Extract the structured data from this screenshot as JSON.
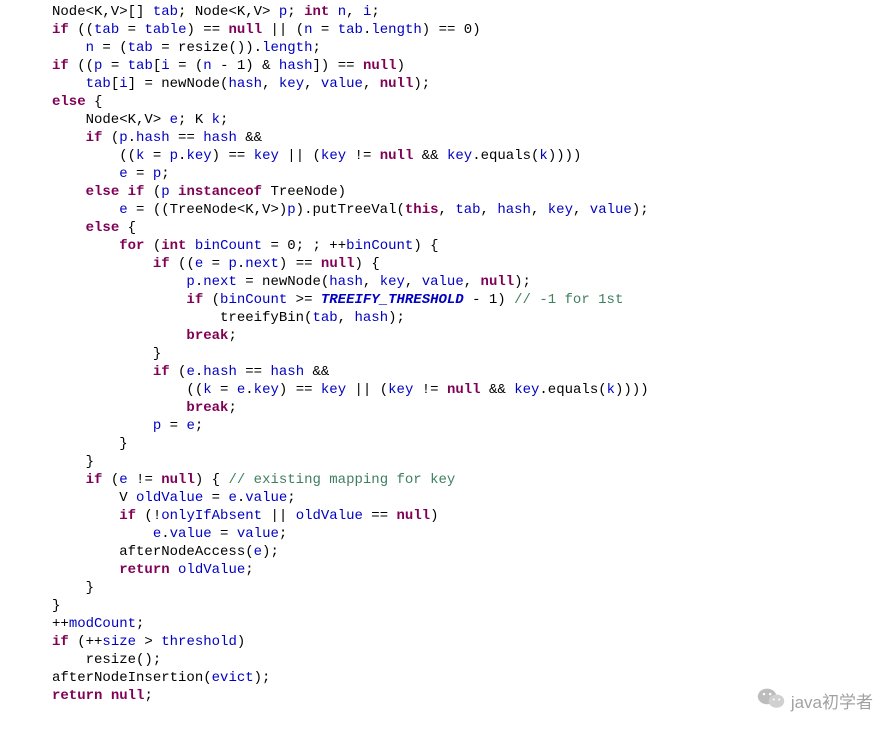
{
  "code": {
    "tokens": [
      [
        {
          "c": "type",
          "t": "Node<K,V>[] "
        },
        {
          "c": "field",
          "t": "tab"
        },
        {
          "t": "; Node<K,V> "
        },
        {
          "c": "field",
          "t": "p"
        },
        {
          "t": "; "
        },
        {
          "c": "kw",
          "t": "int"
        },
        {
          "t": " "
        },
        {
          "c": "field",
          "t": "n"
        },
        {
          "t": ", "
        },
        {
          "c": "field",
          "t": "i"
        },
        {
          "t": ";"
        }
      ],
      [
        {
          "c": "kw",
          "t": "if"
        },
        {
          "t": " (("
        },
        {
          "c": "field",
          "t": "tab"
        },
        {
          "t": " = "
        },
        {
          "c": "field",
          "t": "table"
        },
        {
          "t": ") == "
        },
        {
          "c": "kw",
          "t": "null"
        },
        {
          "t": " || ("
        },
        {
          "c": "field",
          "t": "n"
        },
        {
          "t": " = "
        },
        {
          "c": "field",
          "t": "tab"
        },
        {
          "t": "."
        },
        {
          "c": "field",
          "t": "length"
        },
        {
          "t": ") == 0)"
        }
      ],
      [
        {
          "t": "    "
        },
        {
          "c": "field",
          "t": "n"
        },
        {
          "t": " = ("
        },
        {
          "c": "field",
          "t": "tab"
        },
        {
          "t": " = resize())."
        },
        {
          "c": "field",
          "t": "length"
        },
        {
          "t": ";"
        }
      ],
      [
        {
          "c": "kw",
          "t": "if"
        },
        {
          "t": " (("
        },
        {
          "c": "field",
          "t": "p"
        },
        {
          "t": " = "
        },
        {
          "c": "field",
          "t": "tab"
        },
        {
          "t": "["
        },
        {
          "c": "field",
          "t": "i"
        },
        {
          "t": " = ("
        },
        {
          "c": "field",
          "t": "n"
        },
        {
          "t": " - 1) & "
        },
        {
          "c": "field",
          "t": "hash"
        },
        {
          "t": "]) == "
        },
        {
          "c": "kw",
          "t": "null"
        },
        {
          "t": ")"
        }
      ],
      [
        {
          "t": "    "
        },
        {
          "c": "field",
          "t": "tab"
        },
        {
          "t": "["
        },
        {
          "c": "field",
          "t": "i"
        },
        {
          "t": "] = newNode("
        },
        {
          "c": "field",
          "t": "hash"
        },
        {
          "t": ", "
        },
        {
          "c": "field",
          "t": "key"
        },
        {
          "t": ", "
        },
        {
          "c": "field",
          "t": "value"
        },
        {
          "t": ", "
        },
        {
          "c": "kw",
          "t": "null"
        },
        {
          "t": ");"
        }
      ],
      [
        {
          "c": "kw",
          "t": "else"
        },
        {
          "t": " {"
        }
      ],
      [
        {
          "t": "    Node<K,V> "
        },
        {
          "c": "field",
          "t": "e"
        },
        {
          "t": "; K "
        },
        {
          "c": "field",
          "t": "k"
        },
        {
          "t": ";"
        }
      ],
      [
        {
          "t": "    "
        },
        {
          "c": "kw",
          "t": "if"
        },
        {
          "t": " ("
        },
        {
          "c": "field",
          "t": "p"
        },
        {
          "t": "."
        },
        {
          "c": "field",
          "t": "hash"
        },
        {
          "t": " == "
        },
        {
          "c": "field",
          "t": "hash"
        },
        {
          "t": " &&"
        }
      ],
      [
        {
          "t": "        (("
        },
        {
          "c": "field",
          "t": "k"
        },
        {
          "t": " = "
        },
        {
          "c": "field",
          "t": "p"
        },
        {
          "t": "."
        },
        {
          "c": "field",
          "t": "key"
        },
        {
          "t": ") == "
        },
        {
          "c": "field",
          "t": "key"
        },
        {
          "t": " || ("
        },
        {
          "c": "field",
          "t": "key"
        },
        {
          "t": " != "
        },
        {
          "c": "kw",
          "t": "null"
        },
        {
          "t": " && "
        },
        {
          "c": "field",
          "t": "key"
        },
        {
          "t": ".equals("
        },
        {
          "c": "field",
          "t": "k"
        },
        {
          "t": "))))"
        }
      ],
      [
        {
          "t": "        "
        },
        {
          "c": "field",
          "t": "e"
        },
        {
          "t": " = "
        },
        {
          "c": "field",
          "t": "p"
        },
        {
          "t": ";"
        }
      ],
      [
        {
          "t": "    "
        },
        {
          "c": "kw",
          "t": "else if"
        },
        {
          "t": " ("
        },
        {
          "c": "field",
          "t": "p"
        },
        {
          "t": " "
        },
        {
          "c": "kw",
          "t": "instanceof"
        },
        {
          "t": " TreeNode)"
        }
      ],
      [
        {
          "t": "        "
        },
        {
          "c": "field",
          "t": "e"
        },
        {
          "t": " = ((TreeNode<K,V>)"
        },
        {
          "c": "field",
          "t": "p"
        },
        {
          "t": ").putTreeVal("
        },
        {
          "c": "kw",
          "t": "this"
        },
        {
          "t": ", "
        },
        {
          "c": "field",
          "t": "tab"
        },
        {
          "t": ", "
        },
        {
          "c": "field",
          "t": "hash"
        },
        {
          "t": ", "
        },
        {
          "c": "field",
          "t": "key"
        },
        {
          "t": ", "
        },
        {
          "c": "field",
          "t": "value"
        },
        {
          "t": ");"
        }
      ],
      [
        {
          "t": "    "
        },
        {
          "c": "kw",
          "t": "else"
        },
        {
          "t": " {"
        }
      ],
      [
        {
          "t": "        "
        },
        {
          "c": "kw",
          "t": "for"
        },
        {
          "t": " ("
        },
        {
          "c": "kw",
          "t": "int"
        },
        {
          "t": " "
        },
        {
          "c": "field",
          "t": "binCount"
        },
        {
          "t": " = 0; ; ++"
        },
        {
          "c": "field",
          "t": "binCount"
        },
        {
          "t": ") {"
        }
      ],
      [
        {
          "t": "            "
        },
        {
          "c": "kw",
          "t": "if"
        },
        {
          "t": " (("
        },
        {
          "c": "field",
          "t": "e"
        },
        {
          "t": " = "
        },
        {
          "c": "field",
          "t": "p"
        },
        {
          "t": "."
        },
        {
          "c": "field",
          "t": "next"
        },
        {
          "t": ") == "
        },
        {
          "c": "kw",
          "t": "null"
        },
        {
          "t": ") {"
        }
      ],
      [
        {
          "t": "                "
        },
        {
          "c": "field",
          "t": "p"
        },
        {
          "t": "."
        },
        {
          "c": "field",
          "t": "next"
        },
        {
          "t": " = newNode("
        },
        {
          "c": "field",
          "t": "hash"
        },
        {
          "t": ", "
        },
        {
          "c": "field",
          "t": "key"
        },
        {
          "t": ", "
        },
        {
          "c": "field",
          "t": "value"
        },
        {
          "t": ", "
        },
        {
          "c": "kw",
          "t": "null"
        },
        {
          "t": ");"
        }
      ],
      [
        {
          "t": "                "
        },
        {
          "c": "kw",
          "t": "if"
        },
        {
          "t": " ("
        },
        {
          "c": "field",
          "t": "binCount"
        },
        {
          "t": " >= "
        },
        {
          "c": "const",
          "t": "TREEIFY_THRESHOLD"
        },
        {
          "t": " - 1) "
        },
        {
          "c": "comment",
          "t": "// -1 for 1st"
        }
      ],
      [
        {
          "t": "                    treeifyBin("
        },
        {
          "c": "field",
          "t": "tab"
        },
        {
          "t": ", "
        },
        {
          "c": "field",
          "t": "hash"
        },
        {
          "t": ");"
        }
      ],
      [
        {
          "t": "                "
        },
        {
          "c": "kw",
          "t": "break"
        },
        {
          "t": ";"
        }
      ],
      [
        {
          "t": "            }"
        }
      ],
      [
        {
          "t": "            "
        },
        {
          "c": "kw",
          "t": "if"
        },
        {
          "t": " ("
        },
        {
          "c": "field",
          "t": "e"
        },
        {
          "t": "."
        },
        {
          "c": "field",
          "t": "hash"
        },
        {
          "t": " == "
        },
        {
          "c": "field",
          "t": "hash"
        },
        {
          "t": " &&"
        }
      ],
      [
        {
          "t": "                (("
        },
        {
          "c": "field",
          "t": "k"
        },
        {
          "t": " = "
        },
        {
          "c": "field",
          "t": "e"
        },
        {
          "t": "."
        },
        {
          "c": "field",
          "t": "key"
        },
        {
          "t": ") == "
        },
        {
          "c": "field",
          "t": "key"
        },
        {
          "t": " || ("
        },
        {
          "c": "field",
          "t": "key"
        },
        {
          "t": " != "
        },
        {
          "c": "kw",
          "t": "null"
        },
        {
          "t": " && "
        },
        {
          "c": "field",
          "t": "key"
        },
        {
          "t": ".equals("
        },
        {
          "c": "field",
          "t": "k"
        },
        {
          "t": "))))"
        }
      ],
      [
        {
          "t": "                "
        },
        {
          "c": "kw",
          "t": "break"
        },
        {
          "t": ";"
        }
      ],
      [
        {
          "t": "            "
        },
        {
          "c": "field",
          "t": "p"
        },
        {
          "t": " = "
        },
        {
          "c": "field",
          "t": "e"
        },
        {
          "t": ";"
        }
      ],
      [
        {
          "t": "        }"
        }
      ],
      [
        {
          "t": "    }"
        }
      ],
      [
        {
          "t": "    "
        },
        {
          "c": "kw",
          "t": "if"
        },
        {
          "t": " ("
        },
        {
          "c": "field",
          "t": "e"
        },
        {
          "t": " != "
        },
        {
          "c": "kw",
          "t": "null"
        },
        {
          "t": ") { "
        },
        {
          "c": "comment",
          "t": "// existing mapping for key"
        }
      ],
      [
        {
          "t": "        V "
        },
        {
          "c": "field",
          "t": "oldValue"
        },
        {
          "t": " = "
        },
        {
          "c": "field",
          "t": "e"
        },
        {
          "t": "."
        },
        {
          "c": "field",
          "t": "value"
        },
        {
          "t": ";"
        }
      ],
      [
        {
          "t": "        "
        },
        {
          "c": "kw",
          "t": "if"
        },
        {
          "t": " (!"
        },
        {
          "c": "field",
          "t": "onlyIfAbsent"
        },
        {
          "t": " || "
        },
        {
          "c": "field",
          "t": "oldValue"
        },
        {
          "t": " == "
        },
        {
          "c": "kw",
          "t": "null"
        },
        {
          "t": ")"
        }
      ],
      [
        {
          "t": "            "
        },
        {
          "c": "field",
          "t": "e"
        },
        {
          "t": "."
        },
        {
          "c": "field",
          "t": "value"
        },
        {
          "t": " = "
        },
        {
          "c": "field",
          "t": "value"
        },
        {
          "t": ";"
        }
      ],
      [
        {
          "t": "        afterNodeAccess("
        },
        {
          "c": "field",
          "t": "e"
        },
        {
          "t": ");"
        }
      ],
      [
        {
          "t": "        "
        },
        {
          "c": "kw",
          "t": "return"
        },
        {
          "t": " "
        },
        {
          "c": "field",
          "t": "oldValue"
        },
        {
          "t": ";"
        }
      ],
      [
        {
          "t": "    }"
        }
      ],
      [
        {
          "t": "}"
        }
      ],
      [
        {
          "t": "++"
        },
        {
          "c": "field",
          "t": "modCount"
        },
        {
          "t": ";"
        }
      ],
      [
        {
          "c": "kw",
          "t": "if"
        },
        {
          "t": " (++"
        },
        {
          "c": "field",
          "t": "size"
        },
        {
          "t": " > "
        },
        {
          "c": "field",
          "t": "threshold"
        },
        {
          "t": ")"
        }
      ],
      [
        {
          "t": "    resize();"
        }
      ],
      [
        {
          "t": "afterNodeInsertion("
        },
        {
          "c": "field",
          "t": "evict"
        },
        {
          "t": ");"
        }
      ],
      [
        {
          "c": "kw",
          "t": "return"
        },
        {
          "t": " "
        },
        {
          "c": "kw",
          "t": "null"
        },
        {
          "t": ";"
        }
      ]
    ]
  },
  "watermark": {
    "text": "java初学者"
  }
}
